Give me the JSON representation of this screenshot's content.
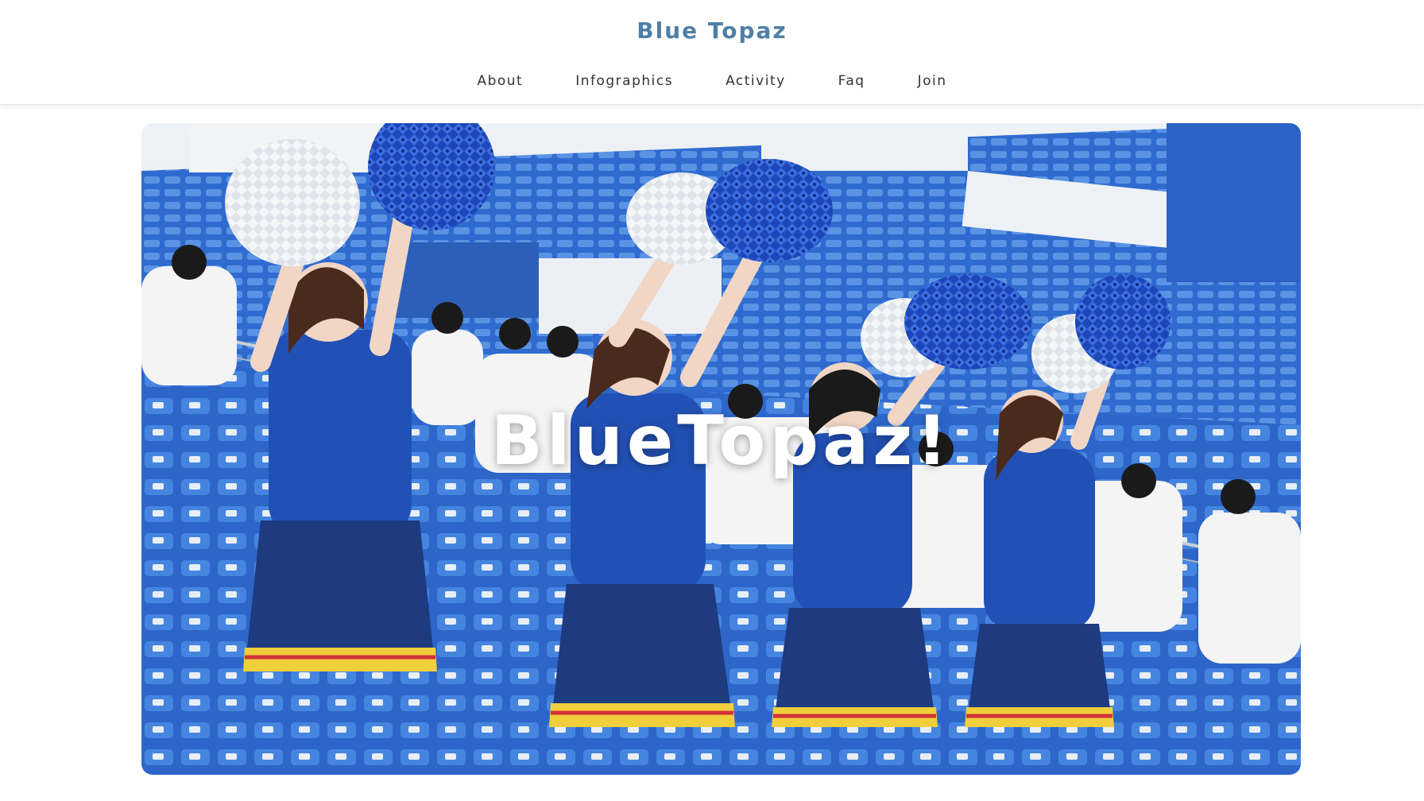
{
  "header": {
    "brand": "Blue Topaz",
    "nav": [
      {
        "label": "About"
      },
      {
        "label": "Infographics"
      },
      {
        "label": "Activity"
      },
      {
        "label": "Faq"
      },
      {
        "label": "Join"
      }
    ]
  },
  "hero": {
    "title": "BlueTopaz!",
    "image": "cheerleaders-in-stadium-photo"
  },
  "colors": {
    "brand": "#4f7fa6",
    "nav_text": "#333333",
    "seat_blue": "#2f6fcf",
    "uniform_blue": "#1f4fae"
  }
}
